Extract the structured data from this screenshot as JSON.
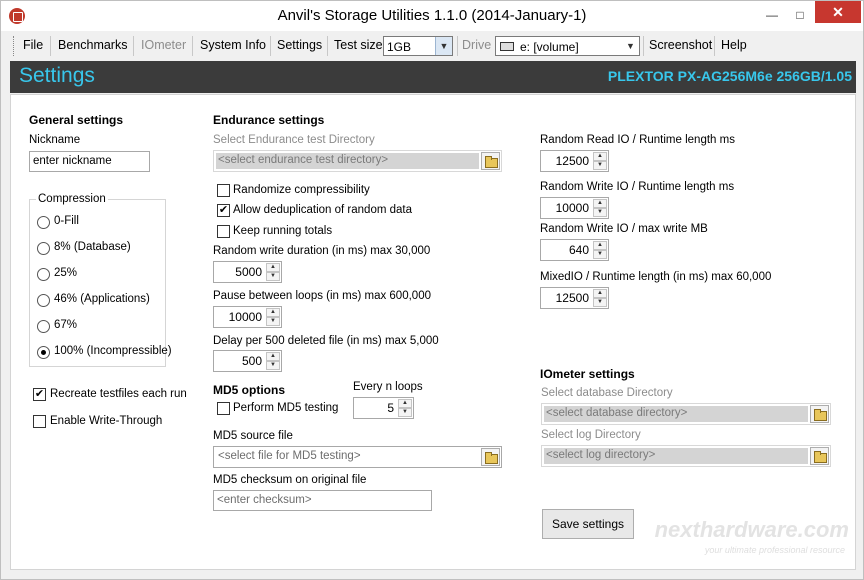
{
  "window": {
    "title": "Anvil's Storage Utilities 1.1.0 (2014-January-1)",
    "minimize": "—",
    "maximize": "□",
    "close": "✕"
  },
  "menu": {
    "file": "File",
    "benchmarks": "Benchmarks",
    "iometer": "IOmeter",
    "system_info": "System Info",
    "settings": "Settings",
    "test_size_label": "Test size",
    "test_size_value": "1GB",
    "drive_label": "Drive",
    "drive_value": "e: [volume]",
    "screenshot": "Screenshot",
    "help": "Help"
  },
  "header": {
    "title": "Settings",
    "drive": "PLEXTOR PX-AG256M6e 256GB/1.05"
  },
  "general": {
    "heading": "General settings",
    "nickname_label": "Nickname",
    "nickname_value": "enter nickname",
    "compression_label": "Compression",
    "compression_options": [
      "0-Fill",
      "8% (Database)",
      "25%",
      "46% (Applications)",
      "67%",
      "100% (Incompressible)"
    ],
    "compression_selected": "100% (Incompressible)",
    "recreate_label": "Recreate testfiles each run",
    "recreate_checked": true,
    "write_through_label": "Enable Write-Through",
    "write_through_checked": false
  },
  "endurance": {
    "heading": "Endurance settings",
    "dir_label": "Select Endurance test Directory",
    "dir_placeholder": "<select endurance test directory>",
    "randomize_label": "Randomize compressibility",
    "randomize_checked": false,
    "dedup_label": "Allow deduplication of random data",
    "dedup_checked": true,
    "keep_totals_label": "Keep running totals",
    "keep_totals_checked": false,
    "rw_duration_label": "Random write duration (in ms) max 30,000",
    "rw_duration_value": "5000",
    "pause_label": "Pause between loops (in ms) max 600,000",
    "pause_value": "10000",
    "delay_label": "Delay per 500 deleted file (in ms) max 5,000",
    "delay_value": "500"
  },
  "md5": {
    "heading": "MD5 options",
    "perform_label": "Perform MD5 testing",
    "perform_checked": false,
    "every_label": "Every n loops",
    "every_value": "5",
    "source_label": "MD5 source file",
    "source_placeholder": "<select file for MD5 testing>",
    "checksum_label": "MD5 checksum on original file",
    "checksum_placeholder": "<enter checksum>"
  },
  "runtime": {
    "rr_label": "Random Read IO / Runtime length ms",
    "rr_value": "12500",
    "rw_label": "Random Write IO / Runtime length ms",
    "rw_value": "10000",
    "rw_max_label": "Random Write IO / max write MB",
    "rw_max_value": "640",
    "mixed_label": "MixedIO / Runtime length (in ms) max 60,000",
    "mixed_value": "12500"
  },
  "iometer": {
    "heading": "IOmeter settings",
    "db_label": "Select database Directory",
    "db_placeholder": "<select database directory>",
    "log_label": "Select log Directory",
    "log_placeholder": "<select log directory>"
  },
  "actions": {
    "save": "Save settings"
  },
  "watermark": {
    "brand": "nexthardware.com",
    "tagline": "your ultimate professional resource"
  }
}
